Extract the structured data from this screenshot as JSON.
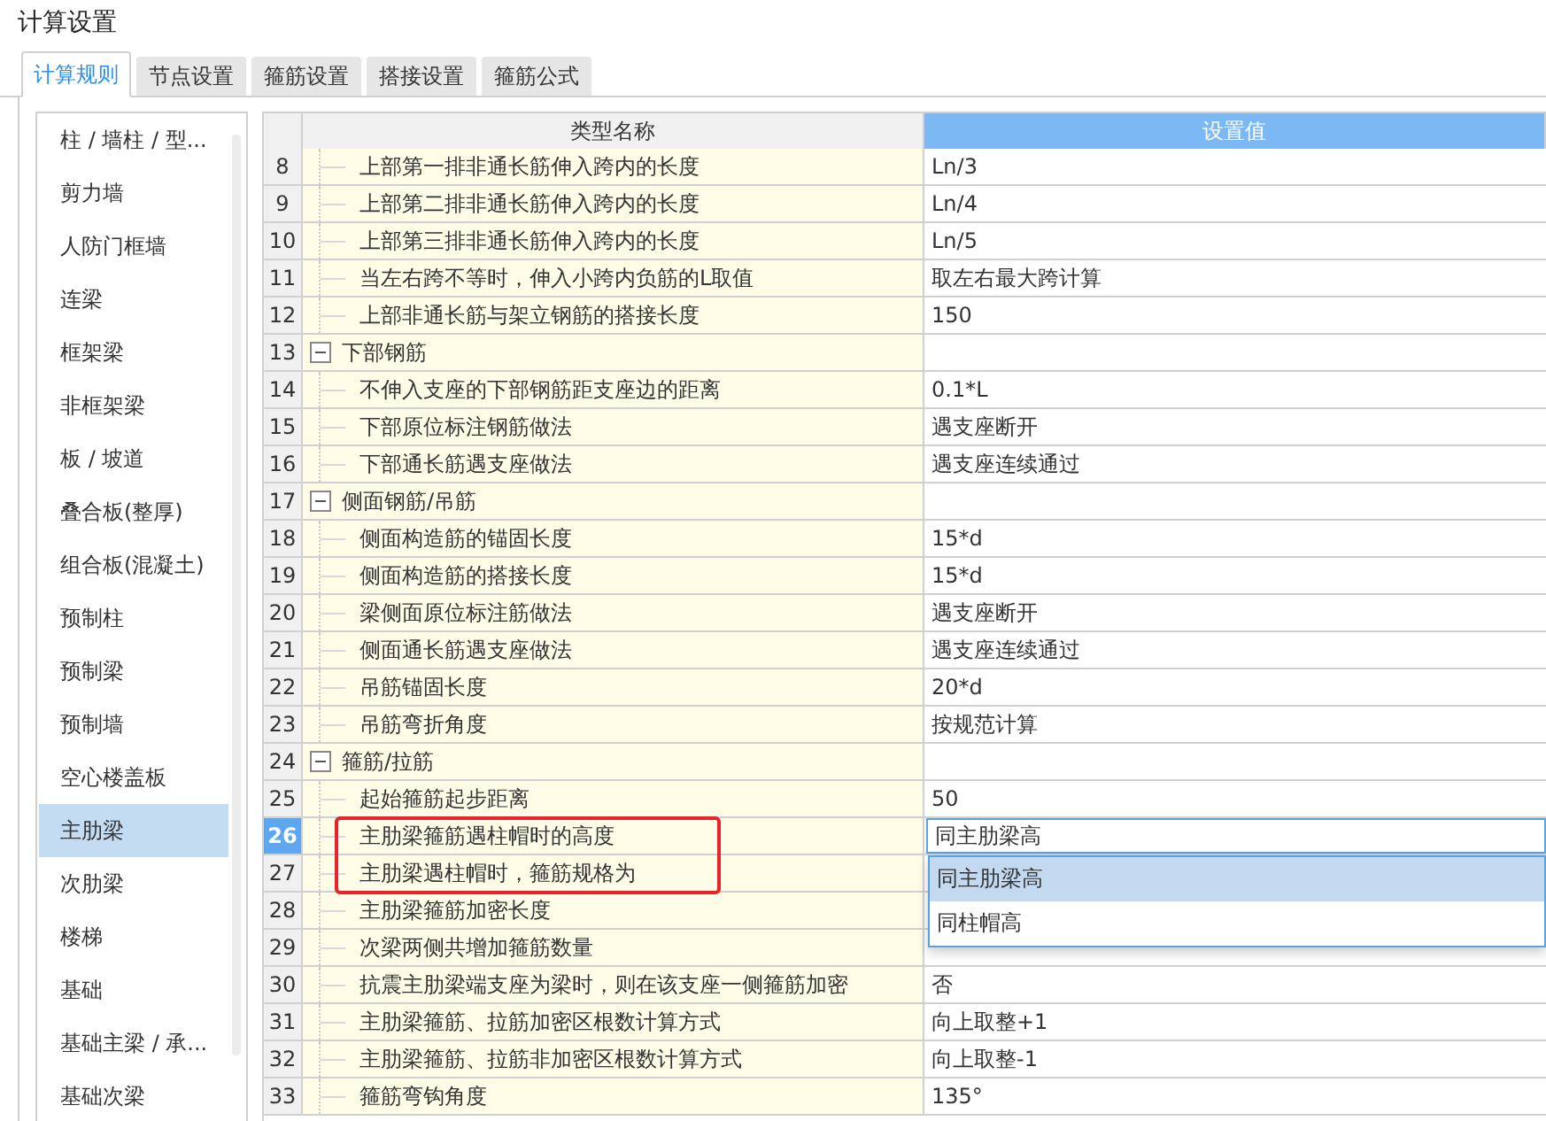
{
  "window": {
    "title": "计算设置"
  },
  "tabs": [
    {
      "label": "计算规则",
      "selected": true
    },
    {
      "label": "节点设置",
      "selected": false
    },
    {
      "label": "箍筋设置",
      "selected": false
    },
    {
      "label": "搭接设置",
      "selected": false
    },
    {
      "label": "箍筋公式",
      "selected": false
    }
  ],
  "sidebar": {
    "items": [
      {
        "label": "柱 / 墙柱 / 型...",
        "selected": false
      },
      {
        "label": "剪力墙",
        "selected": false
      },
      {
        "label": "人防门框墙",
        "selected": false
      },
      {
        "label": "连梁",
        "selected": false
      },
      {
        "label": "框架梁",
        "selected": false
      },
      {
        "label": "非框架梁",
        "selected": false
      },
      {
        "label": "板 / 坡道",
        "selected": false
      },
      {
        "label": "叠合板(整厚)",
        "selected": false
      },
      {
        "label": "组合板(混凝土)",
        "selected": false
      },
      {
        "label": "预制柱",
        "selected": false
      },
      {
        "label": "预制梁",
        "selected": false
      },
      {
        "label": "预制墙",
        "selected": false
      },
      {
        "label": "空心楼盖板",
        "selected": false
      },
      {
        "label": "主肋梁",
        "selected": true
      },
      {
        "label": "次肋梁",
        "selected": false
      },
      {
        "label": "楼梯",
        "selected": false
      },
      {
        "label": "基础",
        "selected": false
      },
      {
        "label": "基础主梁 / 承...",
        "selected": false
      },
      {
        "label": "基础次梁",
        "selected": false
      }
    ]
  },
  "table": {
    "columns": [
      "类型名称",
      "设置值"
    ],
    "rows": [
      {
        "number": "8",
        "kind": "item",
        "name": "上部第一排非通长筋伸入跨内的长度",
        "value": "Ln/3",
        "selected": false,
        "marked": false
      },
      {
        "number": "9",
        "kind": "item",
        "name": "上部第二排非通长筋伸入跨内的长度",
        "value": "Ln/4",
        "selected": false,
        "marked": false
      },
      {
        "number": "10",
        "kind": "item",
        "name": "上部第三排非通长筋伸入跨内的长度",
        "value": "Ln/5",
        "selected": false,
        "marked": false
      },
      {
        "number": "11",
        "kind": "item",
        "name": "当左右跨不等时，伸入小跨内负筋的L取值",
        "value": "取左右最大跨计算",
        "selected": false,
        "marked": false
      },
      {
        "number": "12",
        "kind": "item",
        "name": "上部非通长筋与架立钢筋的搭接长度",
        "value": "150",
        "selected": false,
        "marked": false
      },
      {
        "number": "13",
        "kind": "group",
        "name": "下部钢筋",
        "expanded": true,
        "selected": false,
        "marked": false
      },
      {
        "number": "14",
        "kind": "item",
        "name": "不伸入支座的下部钢筋距支座边的距离",
        "value": "0.1*L",
        "selected": false,
        "marked": false
      },
      {
        "number": "15",
        "kind": "item",
        "name": "下部原位标注钢筋做法",
        "value": "遇支座断开",
        "selected": false,
        "marked": false
      },
      {
        "number": "16",
        "kind": "item",
        "name": "下部通长筋遇支座做法",
        "value": "遇支座连续通过",
        "selected": false,
        "marked": false
      },
      {
        "number": "17",
        "kind": "group",
        "name": "侧面钢筋/吊筋",
        "expanded": true,
        "selected": false,
        "marked": false
      },
      {
        "number": "18",
        "kind": "item",
        "name": "侧面构造筋的锚固长度",
        "value": "15*d",
        "selected": false,
        "marked": false
      },
      {
        "number": "19",
        "kind": "item",
        "name": "侧面构造筋的搭接长度",
        "value": "15*d",
        "selected": false,
        "marked": false
      },
      {
        "number": "20",
        "kind": "item",
        "name": "梁侧面原位标注筋做法",
        "value": "遇支座断开",
        "selected": false,
        "marked": false
      },
      {
        "number": "21",
        "kind": "item",
        "name": "侧面通长筋遇支座做法",
        "value": "遇支座连续通过",
        "selected": false,
        "marked": false
      },
      {
        "number": "22",
        "kind": "item",
        "name": "吊筋锚固长度",
        "value": "20*d",
        "selected": false,
        "marked": false
      },
      {
        "number": "23",
        "kind": "item",
        "name": "吊筋弯折角度",
        "value": "按规范计算",
        "selected": false,
        "marked": false
      },
      {
        "number": "24",
        "kind": "group",
        "name": "箍筋/拉筋",
        "expanded": true,
        "selected": false,
        "marked": false
      },
      {
        "number": "25",
        "kind": "item",
        "name": "起始箍筋起步距离",
        "value": "50",
        "selected": false,
        "marked": false
      },
      {
        "number": "26",
        "kind": "item",
        "name": "主肋梁箍筋遇柱帽时的高度",
        "value": "同主肋梁高",
        "selected": true,
        "marked": true,
        "dropdown": [
          {
            "label": "同主肋梁高",
            "selected": true
          },
          {
            "label": "同柱帽高",
            "selected": false
          }
        ]
      },
      {
        "number": "27",
        "kind": "item",
        "name": "主肋梁遇柱帽时，箍筋规格为",
        "selected": false,
        "marked": true
      },
      {
        "number": "28",
        "kind": "item",
        "name": "主肋梁箍筋加密长度",
        "selected": false,
        "marked": false
      },
      {
        "number": "29",
        "kind": "item",
        "name": "次梁两侧共增加箍筋数量",
        "selected": false,
        "marked": false
      },
      {
        "number": "30",
        "kind": "item",
        "name": "抗震主肋梁端支座为梁时，则在该支座一侧箍筋加密",
        "value": "否",
        "selected": false,
        "marked": false
      },
      {
        "number": "31",
        "kind": "item",
        "name": "主肋梁箍筋、拉筋加密区根数计算方式",
        "value": "向上取整+1",
        "selected": false,
        "marked": false
      },
      {
        "number": "32",
        "kind": "item",
        "name": "主肋梁箍筋、拉筋非加密区根数计算方式",
        "value": "向上取整-1",
        "selected": false,
        "marked": false
      },
      {
        "number": "33",
        "kind": "item",
        "name": "箍筋弯钩角度",
        "value": "135°",
        "selected": false,
        "marked": false
      }
    ]
  }
}
